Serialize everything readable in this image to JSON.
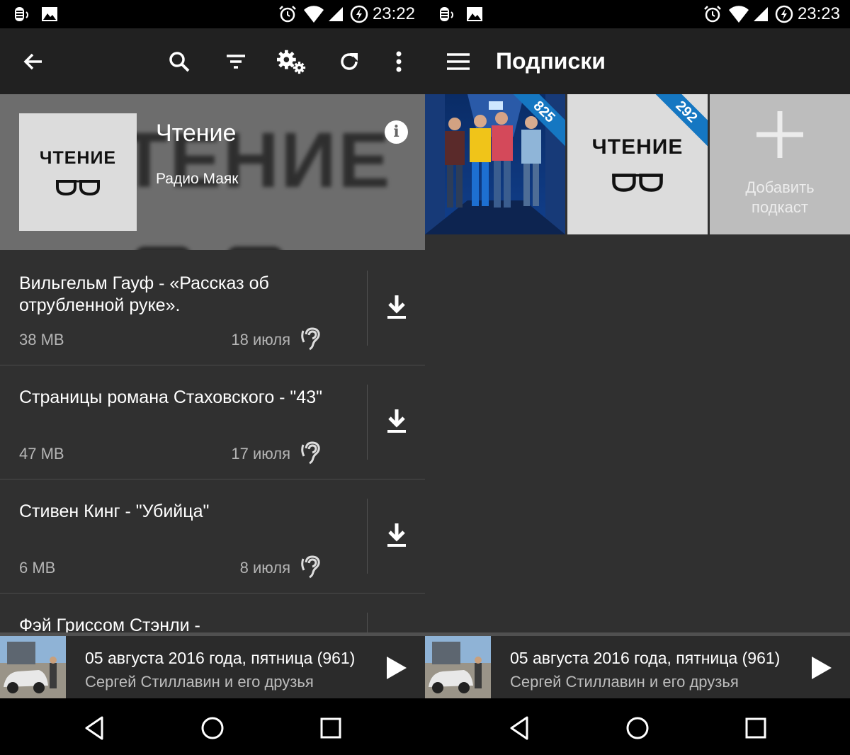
{
  "left_screen": {
    "status": {
      "time": "23:22"
    },
    "toolbar": {
      "back_icon": "arrow-back-icon",
      "search_icon": "search-icon",
      "filter_icon": "filter-icon",
      "settings_icon": "gears-icon",
      "refresh_icon": "refresh-icon",
      "more_icon": "more-vert-icon"
    },
    "podcast": {
      "cover_text": "ЧТЕНИЕ",
      "background_text": "ТЕНИЕ",
      "title": "Чтение",
      "author": "Радио Маяк",
      "info_glyph": "i"
    },
    "episodes": [
      {
        "title": "Вильгельм Гауф - «Рассказ об отрубленной руке».",
        "size": "38 MB",
        "date": "18 июля"
      },
      {
        "title": "Страницы романа Стаховского - \"43\"",
        "size": "47 MB",
        "date": "17 июля"
      },
      {
        "title": "Стивен Кинг - \"Убийца\"",
        "size": "6 MB",
        "date": "8 июля"
      },
      {
        "title": "Фэй Гриссом Стэнли -",
        "size": "",
        "date": ""
      }
    ],
    "player": {
      "title": "05 августа 2016 года, пятница (961)",
      "subtitle": "Сергей Стиллавин и его друзья"
    }
  },
  "right_screen": {
    "status": {
      "time": "23:23"
    },
    "toolbar": {
      "menu_icon": "hamburger-menu-icon",
      "title": "Подписки"
    },
    "subscriptions": [
      {
        "kind": "photo",
        "badge": "825"
      },
      {
        "kind": "cover",
        "cover_text": "ЧТЕНИЕ",
        "badge": "292"
      }
    ],
    "add_tile": {
      "line1": "Добавить",
      "line2": "подкаст"
    },
    "player": {
      "title": "05 августа 2016 года, пятница (961)",
      "subtitle": "Сергей Стиллавин и его друзья"
    }
  },
  "colors": {
    "background": "#303030",
    "toolbar": "#212121",
    "badge": "#1577c2",
    "secondary_text": "#b5b5b5"
  }
}
